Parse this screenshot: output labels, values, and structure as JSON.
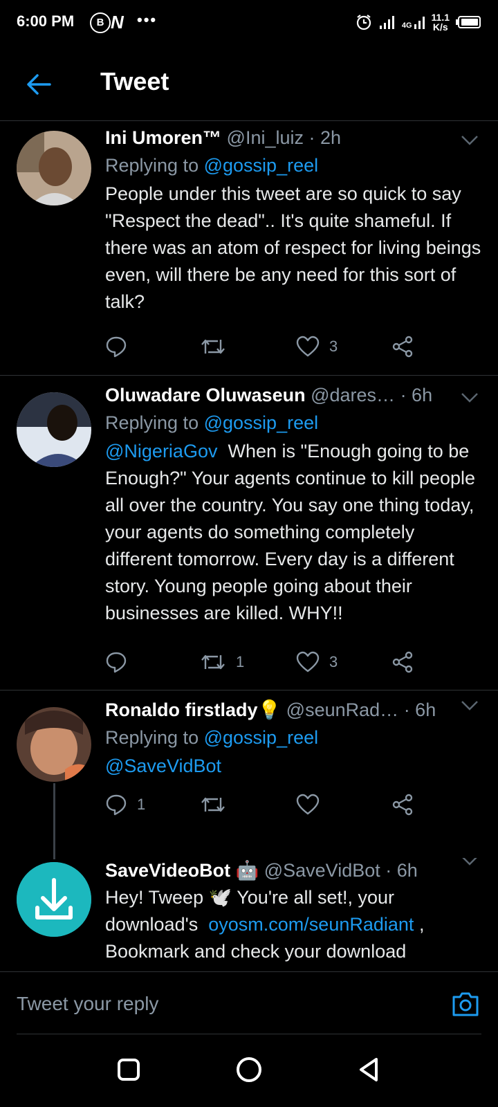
{
  "status_bar": {
    "time": "6:00 PM",
    "badge1": "B",
    "badge2": "N",
    "more": "•••",
    "network": "4G",
    "speed_value": "11.1",
    "speed_unit": "K/s"
  },
  "header": {
    "title": "Tweet"
  },
  "tweets": [
    {
      "name": "Ini Umoren™",
      "handle": "@Ini_luiz",
      "time": "· 2h",
      "replying_prefix": "Replying to",
      "replying_to": "@gossip_reel",
      "mention": "",
      "text": "People under this tweet are so quick to say \"Respect the dead\".. It's quite shameful. If there was an atom of respect for living beings even, will there be any need for this sort of talk?",
      "replies": "",
      "retweets": "",
      "likes": "3"
    },
    {
      "name": "Oluwadare Oluwaseun",
      "handle": "@dares…",
      "time": "· 6h",
      "replying_prefix": "Replying to",
      "replying_to": "@gossip_reel",
      "mention": "@NigeriaGov",
      "text": "When is \"Enough going to be Enough?\" Your agents continue to kill people all over the country. You say one thing today, your agents do something completely different tomorrow. Every day is a different story. Young people going about their businesses are killed. WHY!!",
      "replies": "",
      "retweets": "1",
      "likes": "3"
    },
    {
      "name": "Ronaldo firstlady",
      "name_emoji": "💡",
      "handle": "@seunRad…",
      "time": "· 6h",
      "replying_prefix": "Replying to",
      "replying_to": "@gossip_reel",
      "mention": "@SaveVidBot",
      "text": "",
      "replies": "1",
      "retweets": "",
      "likes": ""
    },
    {
      "name": "SaveVideoBot",
      "name_emoji": "🤖",
      "handle": "@SaveVidBot",
      "time": "· 6h",
      "text_a": "Hey! Tweep",
      "text_emoji": "🕊️",
      "text_b": "You're all set!, your download's",
      "link": "oyosm.com/seunRadiant",
      "text_c": ", Bookmark and check your download"
    }
  ],
  "reply_box": {
    "placeholder": "Tweet your reply"
  },
  "icons": {
    "back": "arrow-left-icon",
    "camera": "camera-icon",
    "reply": "reply-icon",
    "retweet": "retweet-icon",
    "like": "heart-icon",
    "share": "share-icon"
  },
  "colors": {
    "accent": "#1d9bf0",
    "background": "#000000",
    "muted": "#8b98a5"
  }
}
